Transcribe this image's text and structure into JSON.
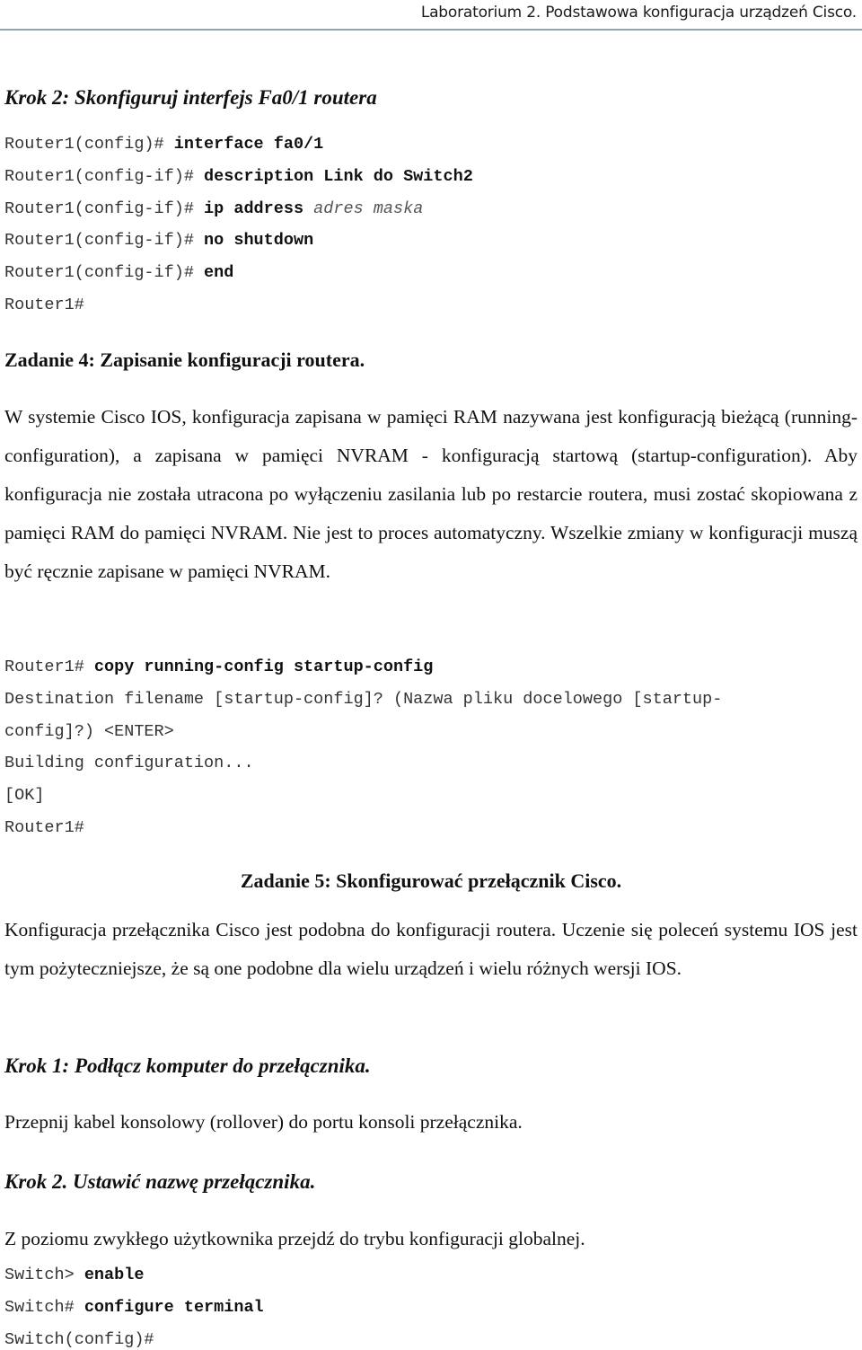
{
  "header": {
    "title": "Laboratorium 2. Podstawowa konfiguracja urządzeń Cisco."
  },
  "krok2_router": {
    "heading": "Krok 2: Skonfiguruj interfejs Fa0/1 routera",
    "lines": [
      {
        "prompt": "Router1(config)# ",
        "cmd": "interface fa0/1",
        "arg": ""
      },
      {
        "prompt": "Router1(config-if)# ",
        "cmd": "description Link do Switch2",
        "arg": ""
      },
      {
        "prompt": "Router1(config-if)# ",
        "cmd": "ip address ",
        "arg": "adres maska"
      },
      {
        "prompt": "Router1(config-if)# ",
        "cmd": "no shutdown",
        "arg": ""
      },
      {
        "prompt": "Router1(config-if)# ",
        "cmd": "end",
        "arg": ""
      },
      {
        "prompt": "Router1#",
        "cmd": "",
        "arg": ""
      }
    ]
  },
  "zadanie4": {
    "heading": "Zadanie 4: Zapisanie konfiguracji routera.",
    "paragraph": "W systemie Cisco IOS, konfiguracja zapisana w pamięci RAM nazywana jest konfiguracją bieżącą (running-configuration), a zapisana w pamięci NVRAM - konfiguracją startową (startup-configuration). Aby konfiguracja nie została utracona po wyłączeniu zasilania lub po restarcie routera, musi zostać skopiowana z pamięci RAM do pamięci NVRAM. Nie jest to proces automatyczny. Wszelkie zmiany w konfiguracji muszą być ręcznie zapisane w pamięci NVRAM.",
    "terminal": [
      {
        "prompt": "Router1# ",
        "cmd": "copy running-config startup-config"
      },
      {
        "prompt": "Destination filename [startup-config]? (Nazwa pliku docelowego [startup-",
        "cmd": ""
      },
      {
        "prompt": "config]?) <ENTER>",
        "cmd": ""
      },
      {
        "prompt": "Building configuration...",
        "cmd": ""
      },
      {
        "prompt": "[OK]",
        "cmd": ""
      },
      {
        "prompt": "Router1#",
        "cmd": ""
      }
    ]
  },
  "zadanie5": {
    "heading": "Zadanie 5: Skonfigurować przełącznik Cisco.",
    "paragraph": "Konfiguracja przełącznika Cisco jest podobna do konfiguracji routera. Uczenie się poleceń systemu IOS jest tym pożyteczniejsze, że są one podobne dla wielu urządzeń i wielu różnych wersji IOS.",
    "krok1_heading": "Krok 1: Podłącz komputer do przełącznika.",
    "krok1_text": "Przepnij kabel konsolowy (rollover) do portu konsoli przełącznika.",
    "krok2_heading": "Krok 2. Ustawić nazwę przełącznika.",
    "krok2_text": "Z poziomu zwykłego użytkownika przejdź do trybu konfiguracji globalnej.",
    "terminal": [
      {
        "prompt": "Switch> ",
        "cmd": "enable"
      },
      {
        "prompt": "Switch# ",
        "cmd": "configure terminal"
      },
      {
        "prompt": "Switch(config)#",
        "cmd": ""
      }
    ]
  }
}
